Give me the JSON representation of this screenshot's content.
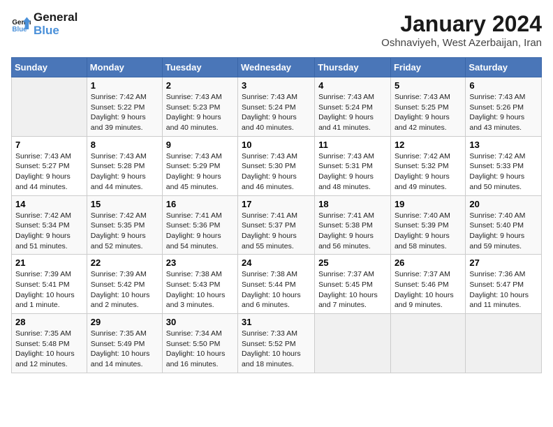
{
  "header": {
    "logo_line1": "General",
    "logo_line2": "Blue",
    "month": "January 2024",
    "location": "Oshnaviyeh, West Azerbaijan, Iran"
  },
  "weekdays": [
    "Sunday",
    "Monday",
    "Tuesday",
    "Wednesday",
    "Thursday",
    "Friday",
    "Saturday"
  ],
  "weeks": [
    [
      {
        "day": null
      },
      {
        "day": "1",
        "sunrise": "7:42 AM",
        "sunset": "5:22 PM",
        "daylight": "9 hours and 39 minutes."
      },
      {
        "day": "2",
        "sunrise": "7:43 AM",
        "sunset": "5:23 PM",
        "daylight": "9 hours and 40 minutes."
      },
      {
        "day": "3",
        "sunrise": "7:43 AM",
        "sunset": "5:24 PM",
        "daylight": "9 hours and 40 minutes."
      },
      {
        "day": "4",
        "sunrise": "7:43 AM",
        "sunset": "5:24 PM",
        "daylight": "9 hours and 41 minutes."
      },
      {
        "day": "5",
        "sunrise": "7:43 AM",
        "sunset": "5:25 PM",
        "daylight": "9 hours and 42 minutes."
      },
      {
        "day": "6",
        "sunrise": "7:43 AM",
        "sunset": "5:26 PM",
        "daylight": "9 hours and 43 minutes."
      }
    ],
    [
      {
        "day": "7",
        "sunrise": "7:43 AM",
        "sunset": "5:27 PM",
        "daylight": "9 hours and 44 minutes."
      },
      {
        "day": "8",
        "sunrise": "7:43 AM",
        "sunset": "5:28 PM",
        "daylight": "9 hours and 44 minutes."
      },
      {
        "day": "9",
        "sunrise": "7:43 AM",
        "sunset": "5:29 PM",
        "daylight": "9 hours and 45 minutes."
      },
      {
        "day": "10",
        "sunrise": "7:43 AM",
        "sunset": "5:30 PM",
        "daylight": "9 hours and 46 minutes."
      },
      {
        "day": "11",
        "sunrise": "7:43 AM",
        "sunset": "5:31 PM",
        "daylight": "9 hours and 48 minutes."
      },
      {
        "day": "12",
        "sunrise": "7:42 AM",
        "sunset": "5:32 PM",
        "daylight": "9 hours and 49 minutes."
      },
      {
        "day": "13",
        "sunrise": "7:42 AM",
        "sunset": "5:33 PM",
        "daylight": "9 hours and 50 minutes."
      }
    ],
    [
      {
        "day": "14",
        "sunrise": "7:42 AM",
        "sunset": "5:34 PM",
        "daylight": "9 hours and 51 minutes."
      },
      {
        "day": "15",
        "sunrise": "7:42 AM",
        "sunset": "5:35 PM",
        "daylight": "9 hours and 52 minutes."
      },
      {
        "day": "16",
        "sunrise": "7:41 AM",
        "sunset": "5:36 PM",
        "daylight": "9 hours and 54 minutes."
      },
      {
        "day": "17",
        "sunrise": "7:41 AM",
        "sunset": "5:37 PM",
        "daylight": "9 hours and 55 minutes."
      },
      {
        "day": "18",
        "sunrise": "7:41 AM",
        "sunset": "5:38 PM",
        "daylight": "9 hours and 56 minutes."
      },
      {
        "day": "19",
        "sunrise": "7:40 AM",
        "sunset": "5:39 PM",
        "daylight": "9 hours and 58 minutes."
      },
      {
        "day": "20",
        "sunrise": "7:40 AM",
        "sunset": "5:40 PM",
        "daylight": "9 hours and 59 minutes."
      }
    ],
    [
      {
        "day": "21",
        "sunrise": "7:39 AM",
        "sunset": "5:41 PM",
        "daylight": "10 hours and 1 minute."
      },
      {
        "day": "22",
        "sunrise": "7:39 AM",
        "sunset": "5:42 PM",
        "daylight": "10 hours and 2 minutes."
      },
      {
        "day": "23",
        "sunrise": "7:38 AM",
        "sunset": "5:43 PM",
        "daylight": "10 hours and 3 minutes."
      },
      {
        "day": "24",
        "sunrise": "7:38 AM",
        "sunset": "5:44 PM",
        "daylight": "10 hours and 6 minutes."
      },
      {
        "day": "25",
        "sunrise": "7:37 AM",
        "sunset": "5:45 PM",
        "daylight": "10 hours and 7 minutes."
      },
      {
        "day": "26",
        "sunrise": "7:37 AM",
        "sunset": "5:46 PM",
        "daylight": "10 hours and 9 minutes."
      },
      {
        "day": "27",
        "sunrise": "7:36 AM",
        "sunset": "5:47 PM",
        "daylight": "10 hours and 11 minutes."
      }
    ],
    [
      {
        "day": "28",
        "sunrise": "7:35 AM",
        "sunset": "5:48 PM",
        "daylight": "10 hours and 12 minutes."
      },
      {
        "day": "29",
        "sunrise": "7:35 AM",
        "sunset": "5:49 PM",
        "daylight": "10 hours and 14 minutes."
      },
      {
        "day": "30",
        "sunrise": "7:34 AM",
        "sunset": "5:50 PM",
        "daylight": "10 hours and 16 minutes."
      },
      {
        "day": "31",
        "sunrise": "7:33 AM",
        "sunset": "5:52 PM",
        "daylight": "10 hours and 18 minutes."
      },
      {
        "day": null
      },
      {
        "day": null
      },
      {
        "day": null
      }
    ]
  ]
}
